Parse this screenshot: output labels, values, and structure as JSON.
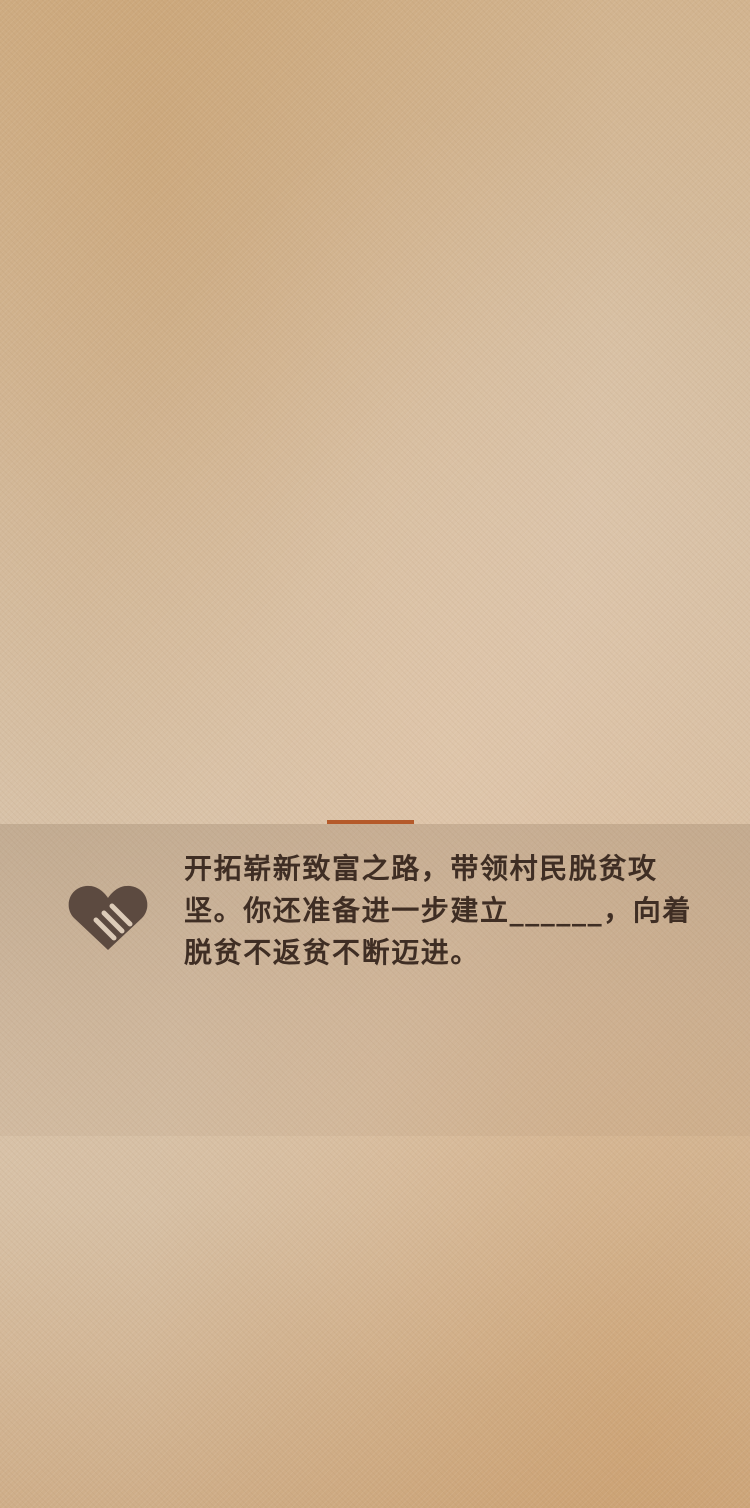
{
  "colors": {
    "accent": "#b55a2a",
    "icon": "#5c4a40",
    "text": "#3f2e24"
  },
  "quiz": {
    "icon_name": "heart-hand-icon",
    "question_text": "开拓崭新致富之路，带领村民脱贫攻坚。你还准备进一步建立______，向着脱贫不返贫不断迈进。"
  }
}
